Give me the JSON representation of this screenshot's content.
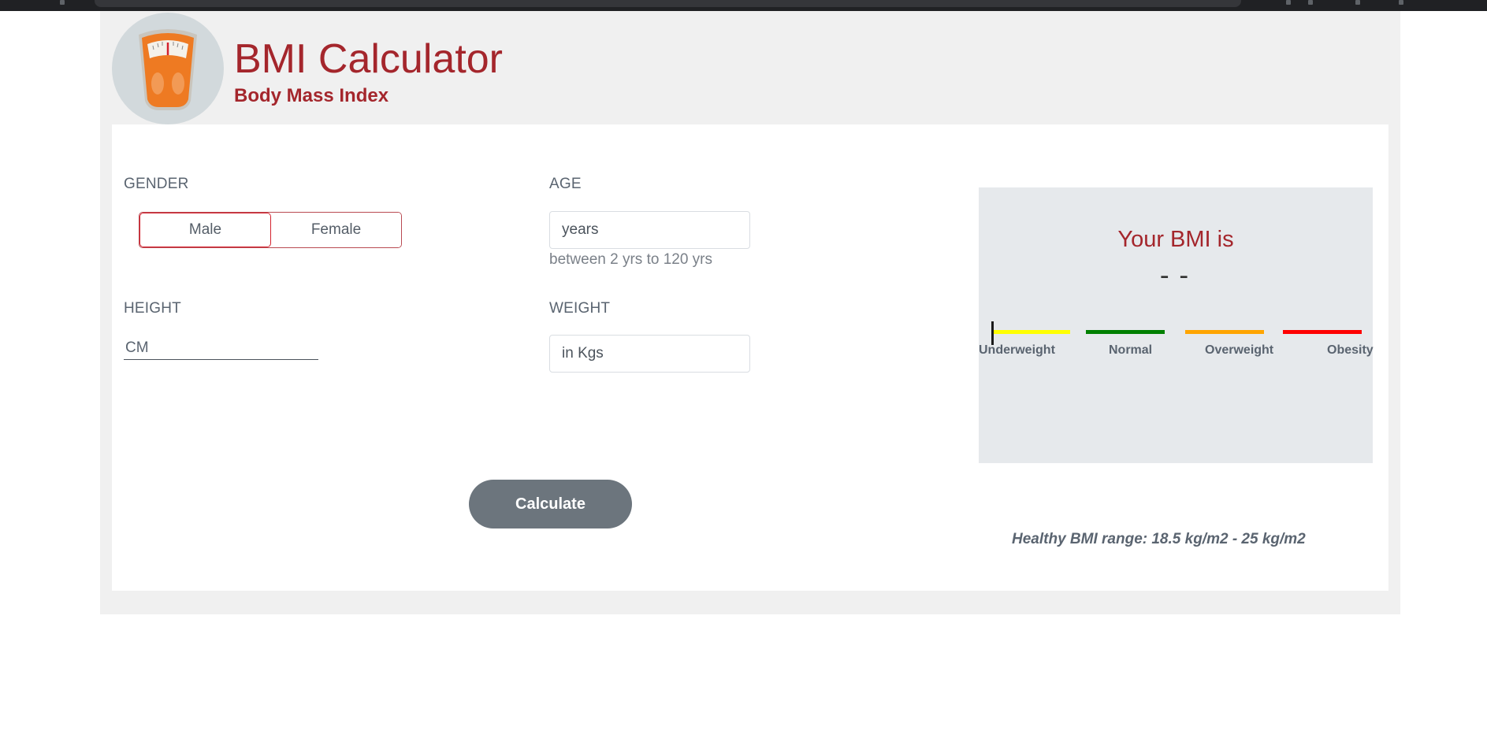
{
  "header": {
    "title": "BMI Calculator",
    "subtitle": "Body Mass Index"
  },
  "form": {
    "gender": {
      "label": "GENDER",
      "options": [
        "Male",
        "Female"
      ],
      "selected": "Male"
    },
    "age": {
      "label": "AGE",
      "placeholder": "years",
      "hint": "between 2 yrs to 120 yrs"
    },
    "height": {
      "label": "HEIGHT",
      "placeholder": "CM"
    },
    "weight": {
      "label": "WEIGHT",
      "placeholder": "in Kgs"
    },
    "calculate_label": "Calculate"
  },
  "result": {
    "title": "Your BMI is",
    "value": "--",
    "scale": [
      {
        "label": "Underweight",
        "color": "#ffff00"
      },
      {
        "label": "Normal",
        "color": "#008000"
      },
      {
        "label": "Overweight",
        "color": "#ffa500"
      },
      {
        "label": "Obesity",
        "color": "#ff0000"
      }
    ],
    "healthy_range": "Healthy BMI range: 18.5 kg/m2 - 25 kg/m2"
  },
  "colors": {
    "brand": "#a4262c",
    "button": "#6c757d",
    "panel": "#e6e9ec"
  }
}
